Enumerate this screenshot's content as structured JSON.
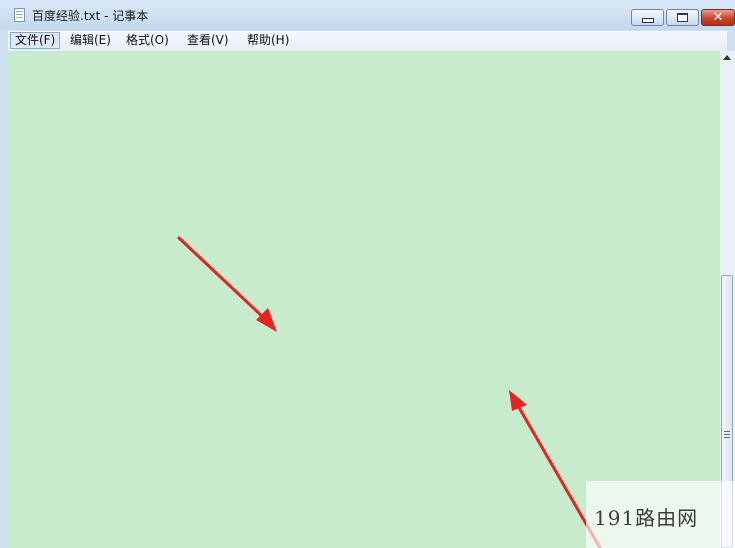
{
  "window": {
    "title": "百度经验.txt - 记事本",
    "icon": "notepad-icon",
    "controls": {
      "minimize_icon": "minimize-icon",
      "maximize_icon": "maximize-icon",
      "close_icon": "close-icon",
      "close_glyph": "✕"
    }
  },
  "menu": {
    "file": "文件(F)",
    "edit": "编辑(E)",
    "format": "格式(O)",
    "view": "查看(V)",
    "help": "帮助(H)"
  },
  "editor": {
    "background_color": "#c8ebcd",
    "content": ""
  },
  "annotations": {
    "arrow_color": "#e8231f"
  },
  "watermark": {
    "text": "191路由网"
  }
}
